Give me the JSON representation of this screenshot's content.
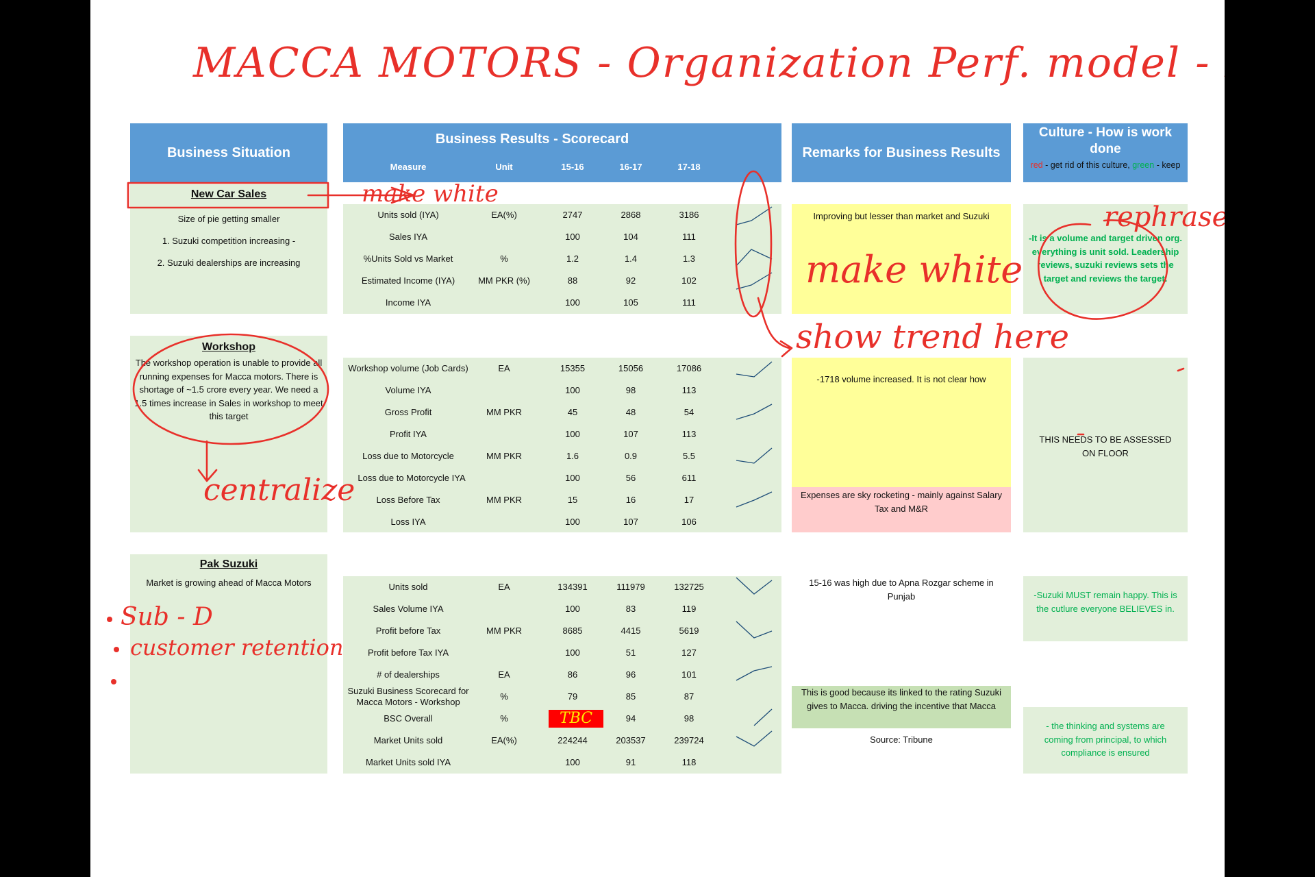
{
  "handwritten_title": "MACCA MOTORS - Organization Perf. model - DRAFT",
  "headers": {
    "business_situation": "Business Situation",
    "scorecard": "Business Results - Scorecard",
    "columns": [
      "Measure",
      "Unit",
      "15-16",
      "16-17",
      "17-18"
    ],
    "remarks": "Remarks for Business Results",
    "culture": "Culture - How is work done",
    "culture_legend": {
      "red": "red",
      "mid": " - get rid of this culture, ",
      "green": "green",
      "end": " - keep"
    }
  },
  "sections": {
    "new_car_sales": {
      "title": "New Car Sales",
      "notes": [
        "Size of pie getting smaller",
        "1. Suzuki competition increasing -",
        "2. Suzuki dealerships are increasing"
      ],
      "rows": [
        {
          "measure": "Units sold (IYA)",
          "unit": "EA(%)",
          "v1": "2747",
          "v2": "2868",
          "v3": "3186"
        },
        {
          "measure": "Sales IYA",
          "unit": "",
          "v1": "100",
          "v2": "104",
          "v3": "111"
        },
        {
          "measure": "%Units Sold vs Market",
          "unit": "%",
          "v1": "1.2",
          "v2": "1.4",
          "v3": "1.3"
        },
        {
          "measure": "Estimated Income (IYA)",
          "unit": "MM PKR (%)",
          "v1": "88",
          "v2": "92",
          "v3": "102"
        },
        {
          "measure": "Income IYA",
          "unit": "",
          "v1": "100",
          "v2": "105",
          "v3": "111"
        }
      ],
      "remark": "Improving but lesser than market and Suzuki",
      "culture": "-It is a volume and target driven org. everything is unit sold. Leadership reviews, suzuki reviews sets the target and reviews the target."
    },
    "workshop": {
      "title": "Workshop",
      "notes": "The workshop operation is unable to provide all running expenses for Macca motors. There is shortage of ~1.5 crore every year. We need a 1.5 times increase in Sales in workshop to meet this target",
      "rows": [
        {
          "measure": "Workshop volume (Job Cards)",
          "unit": "EA",
          "v1": "15355",
          "v2": "15056",
          "v3": "17086"
        },
        {
          "measure": "Volume IYA",
          "unit": "",
          "v1": "100",
          "v2": "98",
          "v3": "113"
        },
        {
          "measure": "Gross Profit",
          "unit": "MM PKR",
          "v1": "45",
          "v2": "48",
          "v3": "54"
        },
        {
          "measure": "Profit IYA",
          "unit": "",
          "v1": "100",
          "v2": "107",
          "v3": "113"
        },
        {
          "measure": "Loss due to Motorcycle",
          "unit": "MM PKR",
          "v1": "1.6",
          "v2": "0.9",
          "v3": "5.5"
        },
        {
          "measure": "Loss due to Motorcycle IYA",
          "unit": "",
          "v1": "100",
          "v2": "56",
          "v3": "611"
        },
        {
          "measure": "Loss Before Tax",
          "unit": "MM PKR",
          "v1": "15",
          "v2": "16",
          "v3": "17"
        },
        {
          "measure": "Loss IYA",
          "unit": "",
          "v1": "100",
          "v2": "107",
          "v3": "106"
        }
      ],
      "remark": "-1718 volume increased. It is not clear how",
      "remark2": "Expenses are sky rocketing - mainly against Salary Tax and M&R",
      "culture": "THIS NEEDS TO BE ASSESSED ON FLOOR"
    },
    "pak_suzuki": {
      "title": "Pak Suzuki",
      "notes": "Market is growing ahead of Macca Motors",
      "rows": [
        {
          "measure": "Units sold",
          "unit": "EA",
          "v1": "134391",
          "v2": "111979",
          "v3": "132725"
        },
        {
          "measure": "Sales Volume IYA",
          "unit": "",
          "v1": "100",
          "v2": "83",
          "v3": "119"
        },
        {
          "measure": "Profit before Tax",
          "unit": "MM PKR",
          "v1": "8685",
          "v2": "4415",
          "v3": "5619"
        },
        {
          "measure": "Profit before Tax IYA",
          "unit": "",
          "v1": "100",
          "v2": "51",
          "v3": "127"
        },
        {
          "measure": "# of dealerships",
          "unit": "EA",
          "v1": "86",
          "v2": "96",
          "v3": "101"
        },
        {
          "measure": "Suzuki Business Scorecard for Macca Motors - Workshop",
          "unit": "%",
          "v1": "79",
          "v2": "85",
          "v3": "87"
        },
        {
          "measure": "BSC Overall",
          "unit": "%",
          "v1": "TBC",
          "v2": "94",
          "v3": "98"
        },
        {
          "measure": "Market Units sold",
          "unit": "EA(%)",
          "v1": "224244",
          "v2": "203537",
          "v3": "239724"
        },
        {
          "measure": "Market Units sold IYA",
          "unit": "",
          "v1": "100",
          "v2": "91",
          "v3": "118"
        }
      ],
      "remark": "15-16 was high due to Apna Rozgar scheme in Punjab",
      "remark2": "This is good because its linked to the rating Suzuki gives to Macca. driving the incentive that Macca",
      "remark3": "Source: Tribune",
      "culture": "-Suzuki MUST remain happy. This is the cutlure everyone BELIEVES in.",
      "culture2": "- the thinking and systems are coming from principal, to which compliance is ensured"
    }
  },
  "annotations": {
    "make_white_1": "make white",
    "make_white_2": "make white",
    "show_trend": "show trend here",
    "rephrase": "rephrase",
    "centralize": "centralize",
    "tbc": "TBC",
    "bullets": [
      "Sub - D",
      "customer retention"
    ]
  },
  "colors": {
    "header": "#5b9bd5",
    "green": "#e2efda",
    "yellow": "#ffff99",
    "pink": "#ffcccc",
    "ink": "#e8302a"
  }
}
